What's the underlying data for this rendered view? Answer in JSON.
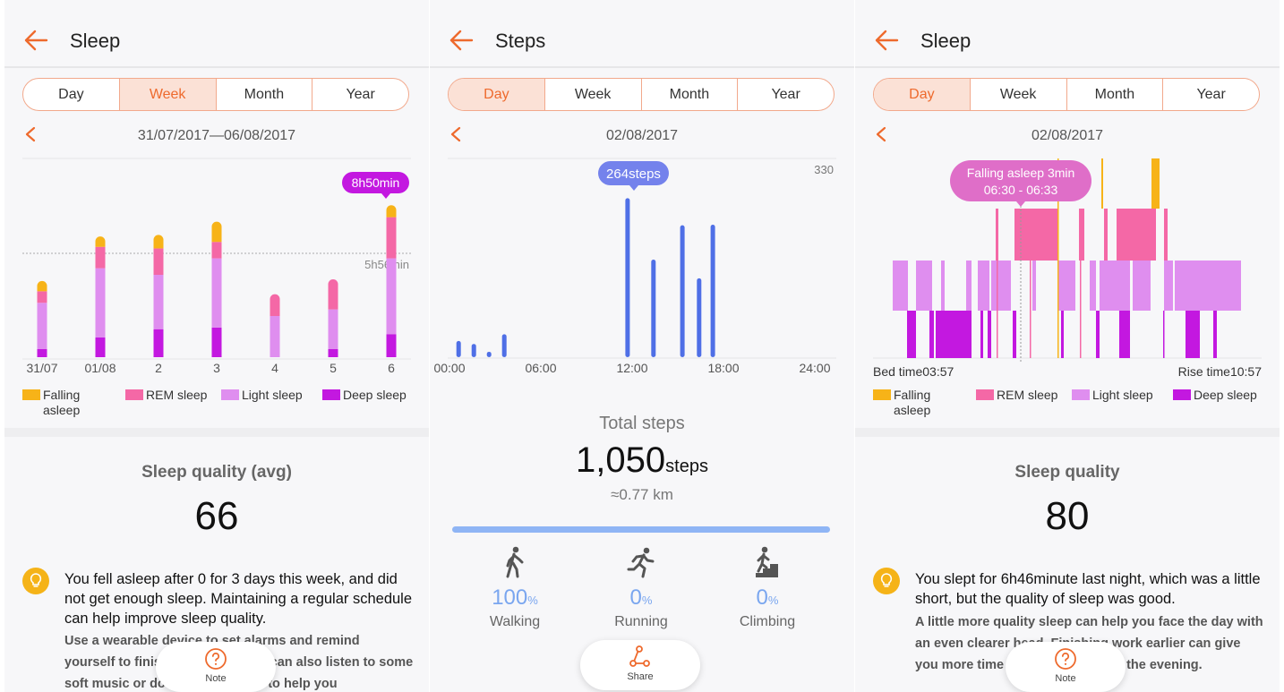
{
  "colors": {
    "accent": "#EE6A2D",
    "falling": "#F7B318",
    "rem": "#F468A6",
    "light": "#DF8EEF",
    "deep": "#C318E0",
    "steps_bar": "#4F6FE6",
    "steps_bubble": "#7482EC",
    "bulb": "#F5B318"
  },
  "panel1": {
    "title": "Sleep",
    "back_icon": "arrow-left-icon",
    "tabs": [
      "Day",
      "Week",
      "Month",
      "Year"
    ],
    "active_tab": "Week",
    "date_range": "31/07/2017—06/08/2017",
    "tooltip": "8h50min",
    "avg_label": "5h56min",
    "legend": [
      "Falling asleep",
      "REM sleep",
      "Light sleep",
      "Deep sleep"
    ],
    "quality_title": "Sleep quality (avg)",
    "quality_value": "66",
    "tip_main": "You fell asleep after 0 for 3 days this week, and did not get enough sleep. Maintaining a regular schedule can help improve sleep quality.",
    "tip_sub": "Use a wearable device to set alarms and remind yourself to finish work early. You can also listen to some soft music or do some stretches to help you",
    "note_label": "Note",
    "note_icon": "question-circle-icon"
  },
  "panel2": {
    "title": "Steps",
    "back_icon": "arrow-left-icon",
    "tabs": [
      "Day",
      "Week",
      "Month",
      "Year"
    ],
    "active_tab": "Day",
    "date": "02/08/2017",
    "y_max_label": "330",
    "tooltip": "264steps",
    "total_title": "Total steps",
    "total_value": "1,050",
    "total_unit": "steps",
    "distance": "≈0.77 km",
    "progress": 1.0,
    "activities": [
      {
        "label": "Walking",
        "value": "100",
        "unit": "%",
        "icon": "walking-icon"
      },
      {
        "label": "Running",
        "value": "0",
        "unit": "%",
        "icon": "running-icon"
      },
      {
        "label": "Climbing",
        "value": "0",
        "unit": "%",
        "icon": "climbing-icon"
      }
    ],
    "share_label": "Share",
    "share_icon": "share-icon"
  },
  "panel3": {
    "title": "Sleep",
    "back_icon": "arrow-left-icon",
    "tabs": [
      "Day",
      "Week",
      "Month",
      "Year"
    ],
    "active_tab": "Day",
    "date": "02/08/2017",
    "tooltip_line1": "Falling asleep 3min",
    "tooltip_line2": "06:30 - 06:33",
    "bed_time": "Bed time03:57",
    "rise_time": "Rise time10:57",
    "legend": [
      "Falling asleep",
      "REM sleep",
      "Light sleep",
      "Deep sleep"
    ],
    "quality_title": "Sleep quality",
    "quality_value": "80",
    "tip_main": "You slept for 6h46minute last night, which was a little short, but the quality of sleep was good.",
    "tip_sub": "A little more quality sleep can help you face the day with an even clearer head. Finishing work earlier can give you more time to relax and rest in the evening.",
    "note_label": "Note",
    "note_icon": "question-circle-icon"
  },
  "chart_data": [
    {
      "type": "bar",
      "stacked": true,
      "title": "",
      "categories": [
        "31/07",
        "01/08",
        "2",
        "3",
        "4",
        "5",
        "6"
      ],
      "series": [
        {
          "name": "Deep sleep",
          "values": [
            0.5,
            1.2,
            1.7,
            1.8,
            0.0,
            0.5,
            1.4
          ]
        },
        {
          "name": "Light sleep",
          "values": [
            2.8,
            4.2,
            3.3,
            4.2,
            2.5,
            2.4,
            4.6
          ]
        },
        {
          "name": "REM sleep",
          "values": [
            0.7,
            1.3,
            1.6,
            1.0,
            1.3,
            1.8,
            2.5
          ]
        },
        {
          "name": "Falling asleep",
          "values": [
            0.6,
            0.6,
            0.8,
            1.2,
            0.0,
            0.0,
            0.7
          ]
        }
      ],
      "avg_line": "5h56min",
      "highlight": {
        "category": "6",
        "label": "8h50min"
      },
      "ylim": [
        0,
        10
      ]
    },
    {
      "type": "bar",
      "title": "",
      "x_labels": [
        "00:00",
        "06:00",
        "12:00",
        "18:00",
        "24:00"
      ],
      "ymax": 330,
      "x": [
        0.6,
        1.6,
        2.6,
        3.6,
        11.7,
        13.4,
        15.3,
        16.4,
        17.3
      ],
      "values": [
        27,
        22,
        9,
        38,
        264,
        162,
        219,
        131,
        220
      ],
      "highlight": {
        "x": 11.7,
        "label": "264steps"
      }
    },
    {
      "type": "timeline",
      "title": "",
      "x_range": [
        "03:57",
        "10:57"
      ],
      "stages": [
        "Falling asleep",
        "REM sleep",
        "Light sleep",
        "Deep sleep"
      ],
      "highlight": {
        "stage": "Falling asleep",
        "label": "Falling asleep 3min",
        "range": "06:30 - 06:33"
      }
    }
  ]
}
